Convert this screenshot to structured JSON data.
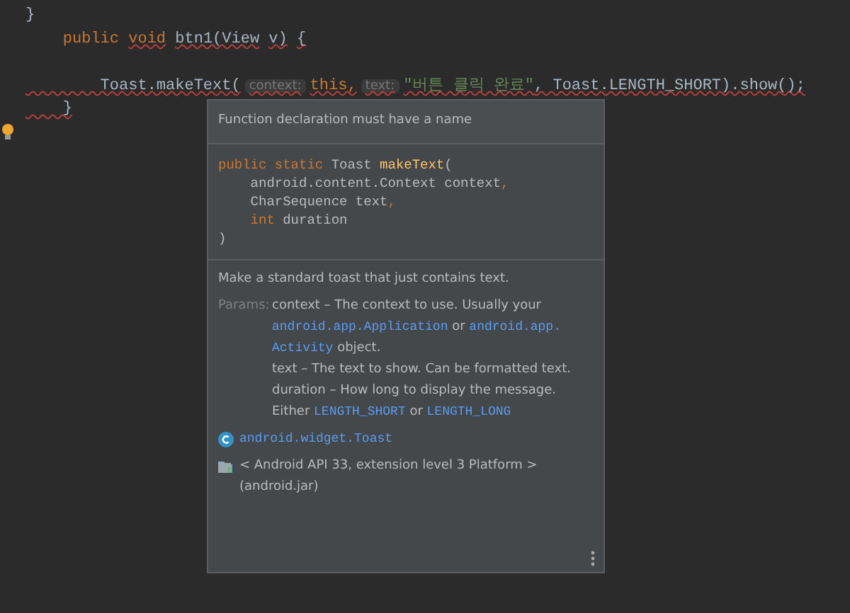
{
  "editor": {
    "lines": [
      {
        "kind": "code",
        "tokens": [
          {
            "text": "}",
            "kind": "plain",
            "error": false,
            "space_before": false
          }
        ]
      },
      {
        "kind": "code",
        "tokens": [
          {
            "text": "    public",
            "kind": "kw",
            "error": false,
            "space_before": false
          },
          {
            "text": "void",
            "kind": "kw",
            "error": true,
            "space_before": true
          },
          {
            "text": "btn1(View",
            "kind": "plain",
            "error": true,
            "space_before": true
          },
          {
            "text": "v)",
            "kind": "plain",
            "error": true,
            "space_before": true
          },
          {
            "text": "{",
            "kind": "plain",
            "error": true,
            "space_before": true
          }
        ]
      },
      {
        "kind": "blank"
      },
      {
        "kind": "code",
        "tokens": [
          {
            "text": "        Toast.makeText(",
            "kind": "plain",
            "error": true,
            "space_before": false
          },
          {
            "text": "context:",
            "kind": "hint",
            "error": true,
            "space_before": false
          },
          {
            "text": "this,",
            "kind": "kw",
            "error": true,
            "space_before": false
          },
          {
            "text": "text:",
            "kind": "hint",
            "error": true,
            "space_before": false
          },
          {
            "text": "\"버튼 클릭 완료\"",
            "kind": "str",
            "error": true,
            "space_before": false
          },
          {
            "text": ", Toast.LENGTH_SHORT).show();",
            "kind": "plain",
            "error": true,
            "space_before": false
          }
        ]
      },
      {
        "kind": "code",
        "tokens": [
          {
            "text": "    }",
            "kind": "plain",
            "error": true,
            "space_before": false
          }
        ]
      }
    ]
  },
  "popup": {
    "error_message": "Function declaration must have a name",
    "signature": [
      [
        {
          "text": "public static ",
          "kind": "kw"
        },
        {
          "text": "Toast ",
          "kind": "plain"
        },
        {
          "text": "makeText",
          "kind": "fn"
        },
        {
          "text": "(",
          "kind": "plain"
        }
      ],
      [
        {
          "text": "    android.content.Context context",
          "kind": "plain"
        },
        {
          "text": ",",
          "kind": "kw"
        }
      ],
      [
        {
          "text": "    CharSequence text",
          "kind": "plain"
        },
        {
          "text": ",",
          "kind": "kw"
        }
      ],
      [
        {
          "text": "    int ",
          "kind": "kw"
        },
        {
          "text": "duration",
          "kind": "plain"
        }
      ],
      [
        {
          "text": ")",
          "kind": "plain"
        }
      ]
    ],
    "description": "Make a standard toast that just contains text.",
    "params_label": "Params:",
    "params": [
      [
        {
          "text": "context – The context to use. Usually your ",
          "kind": "text"
        },
        {
          "text": "android.app.Application",
          "kind": "link"
        },
        {
          "text": " or ",
          "kind": "text"
        },
        {
          "text": "android.app.",
          "kind": "link"
        },
        {
          "text": "Activity",
          "kind": "link"
        },
        {
          "text": " object.",
          "kind": "text"
        }
      ],
      [
        {
          "text": "text – The text to show. Can be formatted text.",
          "kind": "text"
        }
      ],
      [
        {
          "text": "duration – How long to display the message. Either ",
          "kind": "text"
        },
        {
          "text": "LENGTH_SHORT",
          "kind": "link"
        },
        {
          "text": " or ",
          "kind": "text"
        },
        {
          "text": "LENGTH_LONG",
          "kind": "link"
        }
      ]
    ],
    "class_name": "android.widget.Toast",
    "library": "< Android API 33, extension level 3 Platform > (android.jar)"
  }
}
